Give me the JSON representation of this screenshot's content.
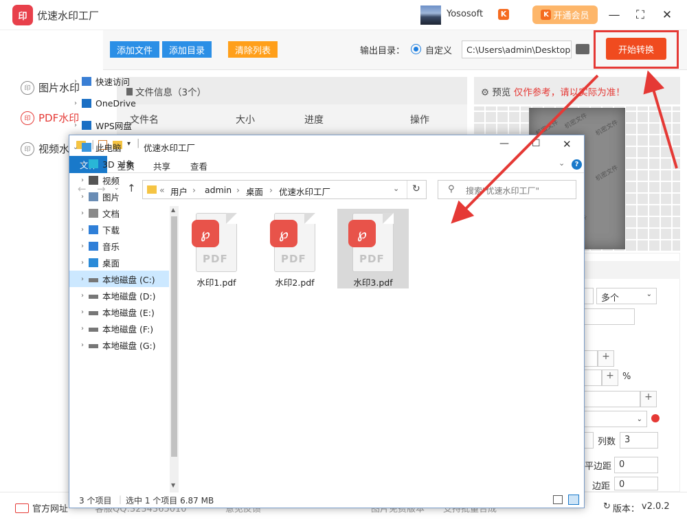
{
  "app": {
    "title": "优速水印工厂",
    "logo_text": "印",
    "username": "Yososoft",
    "vip_button": "开通会员",
    "vip_mark": "K",
    "win_minimize": "—",
    "win_maximize": "⛶",
    "win_close": "✕"
  },
  "sidebar": {
    "items": [
      {
        "label": "图片水印",
        "icon": "印",
        "active": false
      },
      {
        "label": "PDF水印",
        "icon": "印",
        "active": true
      },
      {
        "label": "视频水印",
        "icon": "印",
        "active": false
      }
    ]
  },
  "toolbar": {
    "add_file": "添加文件",
    "add_dir": "添加目录",
    "clear_list": "清除列表",
    "output_label": "输出目录：",
    "custom_label": "自定义",
    "output_path": "C:\\Users\\admin\\Desktop",
    "start_button": "开始转换"
  },
  "fileinfo": {
    "header": "文件信息（3个）",
    "columns": [
      "文件名",
      "大小",
      "进度",
      "操作"
    ]
  },
  "preview": {
    "label": "预览",
    "warning": "仅作参考，请以实际为准！",
    "watermark_text": "机密文件"
  },
  "settings": {
    "layout_value": "多个",
    "percent": "%",
    "cols_label": "列数",
    "cols_value": "3",
    "spacing_value_1": "0",
    "spacing_value_2": "0",
    "label_partial_1": "平边距",
    "label_partial_2": "边距"
  },
  "footer": {
    "website": "官方网址",
    "qq": "客服QQ:3234365010",
    "feedback": "意见反馈",
    "tip1": "图片免费版本",
    "tip2": "支持批量合成",
    "version_label": "版本：",
    "version": "v2.0.2"
  },
  "explorer": {
    "title": "优速水印工厂",
    "ribbon_file": "文件",
    "ribbon_tabs": [
      "主页",
      "共享",
      "查看"
    ],
    "min": "—",
    "max": "☐",
    "close": "✕",
    "breadcrumb": [
      "用户",
      "admin",
      "桌面",
      "优速水印工厂"
    ],
    "search_placeholder": "搜索\"优速水印工厂\"",
    "nav": [
      {
        "label": "快速访问",
        "icon": "star-icon",
        "level": 0
      },
      {
        "label": "OneDrive",
        "icon": "cloud-icon",
        "level": 0
      },
      {
        "label": "WPS网盘",
        "icon": "cloud-icon",
        "level": 0
      },
      {
        "label": "此电脑",
        "icon": "computer-icon",
        "level": 0,
        "expanded": true
      },
      {
        "label": "3D 对象",
        "icon": "cube-icon",
        "level": 1
      },
      {
        "label": "视频",
        "icon": "video-icon",
        "level": 1
      },
      {
        "label": "图片",
        "icon": "picture-icon",
        "level": 1
      },
      {
        "label": "文档",
        "icon": "document-icon",
        "level": 1
      },
      {
        "label": "下载",
        "icon": "download-icon",
        "level": 1
      },
      {
        "label": "音乐",
        "icon": "music-icon",
        "level": 1
      },
      {
        "label": "桌面",
        "icon": "desktop-icon",
        "level": 1
      },
      {
        "label": "本地磁盘 (C:)",
        "icon": "drive-icon",
        "level": 1,
        "selected": true
      },
      {
        "label": "本地磁盘 (D:)",
        "icon": "drive-icon",
        "level": 1
      },
      {
        "label": "本地磁盘 (E:)",
        "icon": "drive-icon",
        "level": 1
      },
      {
        "label": "本地磁盘 (F:)",
        "icon": "drive-icon",
        "level": 1
      },
      {
        "label": "本地磁盘 (G:)",
        "icon": "drive-icon",
        "level": 1
      }
    ],
    "files": [
      {
        "name": "水印1.pdf",
        "badge": "PDF",
        "selected": false
      },
      {
        "name": "水印2.pdf",
        "badge": "PDF",
        "selected": false
      },
      {
        "name": "水印3.pdf",
        "badge": "PDF",
        "selected": true
      }
    ],
    "status_count": "3 个项目",
    "status_selected": "选中 1 个项目  6.87 MB"
  },
  "colors": {
    "accent_red": "#e53935",
    "start_orange": "#f04b1f",
    "toolbar_blue": "#2b8fe6",
    "toolbar_orange": "#ff9f1a",
    "vip_orange": "#fdb66a",
    "explorer_blue": "#1979ca",
    "pdf_red": "#e8534a"
  }
}
